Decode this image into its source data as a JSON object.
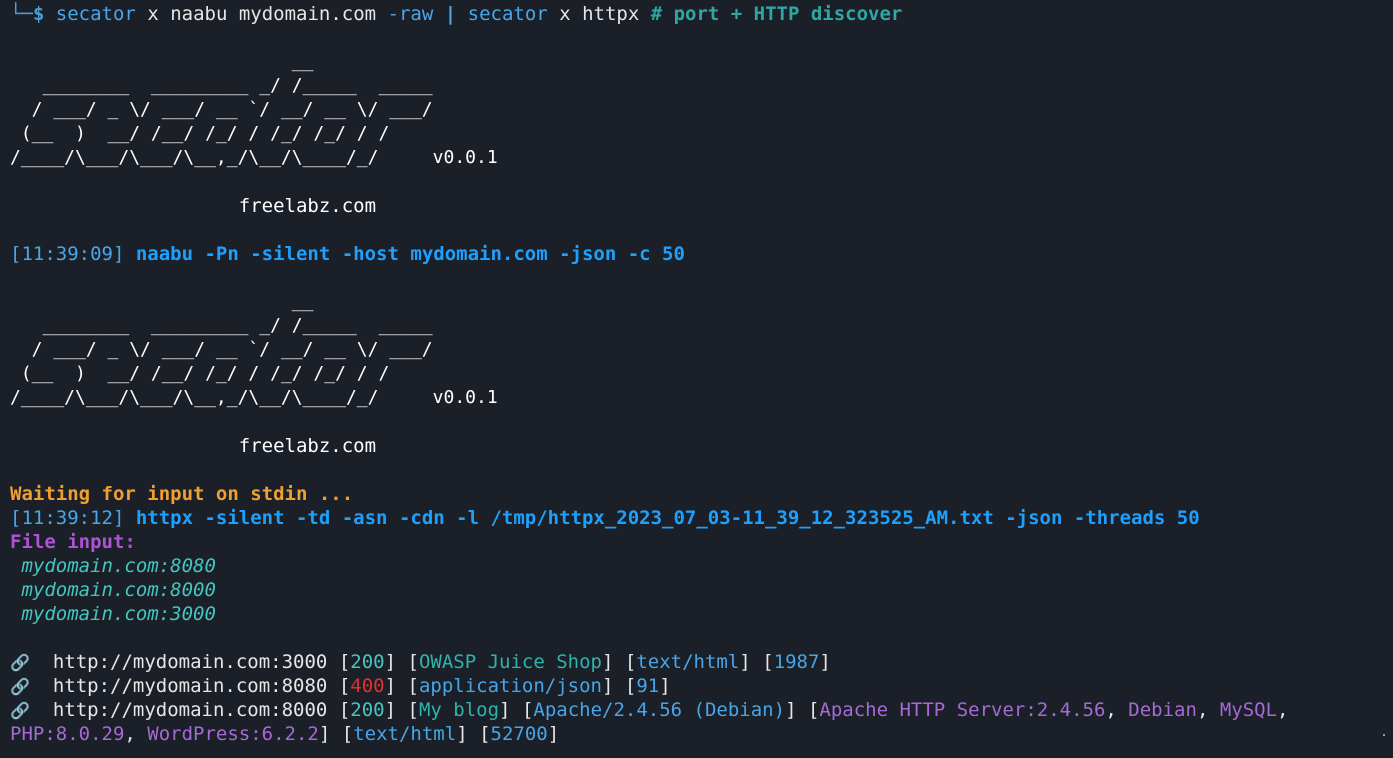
{
  "prompt": {
    "corner": "└─",
    "dollar": "$",
    "part1_cmd": "secator",
    "part1_args": " x naabu mydomain.com ",
    "part1_flag": "-raw",
    "pipe": "|",
    "part2_cmd": "secator",
    "part2_args": " x httpx ",
    "comment": "# port + HTTP discover"
  },
  "banner": {
    "ascii_lines": [
      "                          __            ",
      "   ________  _________ _/ /_____  _____",
      "  / ___/ _ \\/ ___/ __ `/ __/ __ \\/ ___/",
      " (__  )  __/ /__/ /_/ / /_/ /_/ / /    ",
      "/____/\\___/\\___/\\__,_/\\__/\\____/_/     "
    ],
    "version": "v0.0.1",
    "site": "freelabz.com"
  },
  "run1": {
    "timestamp": "[11:39:09]",
    "command": "naabu -Pn -silent -host mydomain.com -json -c 50"
  },
  "waiting": "Waiting for input on stdin ...",
  "run2": {
    "timestamp": "[11:39:12]",
    "command": "httpx -silent -td -asn -cdn -l /tmp/httpx_2023_07_03-11_39_12_323525_AM.txt -json -threads 50"
  },
  "file_input": {
    "label": "File input:",
    "items": [
      "mydomain.com:8080",
      "mydomain.com:8000",
      "mydomain.com:3000"
    ]
  },
  "results": [
    {
      "icon": "link-icon",
      "url": "http://mydomain.com:3000",
      "status": "200",
      "title": "OWASP Juice Shop",
      "content_type": "text/html",
      "length": "1987"
    },
    {
      "icon": "link-icon",
      "url": "http://mydomain.com:8080",
      "status": "400",
      "content_type": "application/json",
      "length": "91"
    },
    {
      "icon": "link-icon",
      "url": "http://mydomain.com:8000",
      "status": "200",
      "title": "My blog",
      "server": "Apache/2.4.56 (Debian)",
      "tech": [
        "Apache HTTP Server:2.4.56",
        "Debian",
        "MySQL",
        "PHP:8.0.29",
        "WordPress:6.2.2"
      ],
      "content_type": "text/html",
      "length": "52700"
    }
  ],
  "colors": {
    "background": "#1b1f27",
    "accent_blue": "#1ea0ff",
    "warning_orange": "#f0a030",
    "purple": "#b052d8",
    "status_ok": "#46c6c0",
    "status_error": "#e23030"
  }
}
